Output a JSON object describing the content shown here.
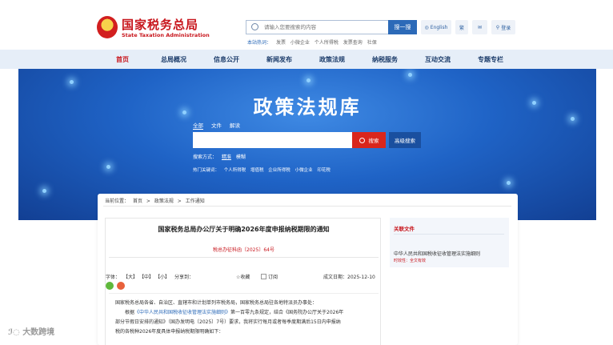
{
  "header": {
    "logo_cn": "国家税务总局",
    "logo_en": "State Taxation Administration",
    "search_placeholder": "请输入您要搜索的内容",
    "search_button": "搜一搜",
    "hot_label": "本站热词：",
    "hot_words": [
      "发票",
      "小微企业",
      "个人所得税",
      "发票查询",
      "社保"
    ],
    "english": "English",
    "traditional": "繁",
    "login": "登录"
  },
  "nav": {
    "items": [
      "首页",
      "总局概况",
      "信息公开",
      "新闻发布",
      "政策法规",
      "纳税服务",
      "互动交流",
      "专题专栏"
    ],
    "active": "首页"
  },
  "banner": {
    "title": "政策法规库",
    "tabs": [
      "全部",
      "文件",
      "解读"
    ],
    "search_button": "搜索",
    "advanced_button": "高级搜索",
    "mode_label": "搜索方式：",
    "modes": [
      "精准",
      "模糊"
    ],
    "hot_label": "热门关键词：",
    "hot_words": [
      "个人所得税",
      "增值税",
      "企业所得税",
      "小微企业",
      "印花税"
    ]
  },
  "breadcrumb": {
    "label": "当前位置：",
    "items": [
      "首页",
      ">",
      "政策法规",
      ">",
      "工作通知"
    ]
  },
  "article": {
    "title": "国家税务总局办公厅关于明确2026年度申报纳税期限的通知",
    "doc_no": "税总办征科函〔2025〕64号",
    "font_label": "字体：",
    "font_sizes": [
      "【大】",
      "【中】",
      "【小】"
    ],
    "share_label": "分享到：",
    "collect": "收藏",
    "subscribe": "订阅",
    "date": "成文日期：2025-12-10",
    "body_line1": "国家税务总局各省、自治区、直辖市和计划单列市税务局，国家税务总局驻各地特派员办事处：",
    "body_line2_a": "根据",
    "body_line2_link": "《中华人民共和国税收征收管理法实施细则》",
    "body_line2_b": "第一百零九条规定，结合《国务院办公厅关于2026年",
    "body_line3": "部分节假日安排的通知》（国办发明电〔2025〕7号）要求，我将实行每月或者每季度期满后15日内申报纳",
    "body_line4": "税的各税种2026年度具体申报纳税期限明确如下："
  },
  "related": {
    "title": "关联文件",
    "item": "中华人民共和国税收征收管理法实施细则",
    "meta": "时效性：全文有效"
  },
  "watermark": "大数跨境",
  "colors": {
    "brand_red": "#c8161d",
    "nav_bg": "#e6eef8",
    "banner_blue": "#1f63c6",
    "button_blue": "#2c6ab8"
  }
}
